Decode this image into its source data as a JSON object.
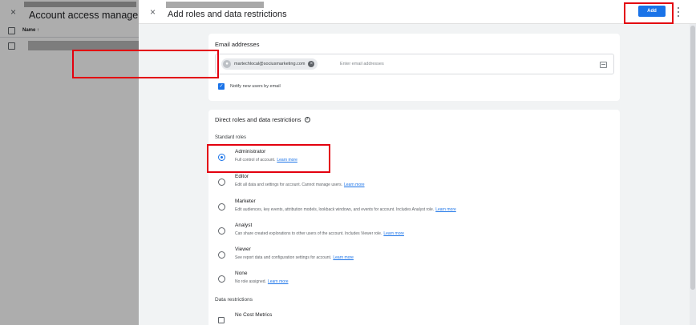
{
  "background_page": {
    "title": "Account access management",
    "close_glyph": "×",
    "column_header": "Name ↑"
  },
  "panel": {
    "title": "Add roles and data restrictions",
    "close_glyph": "×",
    "add_label": "Add"
  },
  "email": {
    "heading": "Email addresses",
    "chip_value": "martechlocal@sociusmarketing.com",
    "placeholder": "Enter email addresses",
    "notify_label": "Notify new users by email",
    "notify_checked": true
  },
  "roles": {
    "heading": "Direct roles and data restrictions",
    "standard_roles_label": "Standard roles",
    "learn_more_label": "Learn more",
    "items": [
      {
        "name": "Administrator",
        "description": "Full control of account.",
        "selected": true
      },
      {
        "name": "Editor",
        "description": "Edit all data and settings for account. Cannot manage users.",
        "selected": false
      },
      {
        "name": "Marketer",
        "description": "Edit audiences, key events, attribution models, lookback windows, and events for account. Includes Analyst role.",
        "selected": false
      },
      {
        "name": "Analyst",
        "description": "Can share created explorations to other users of the account. Includes Viewer role.",
        "selected": false
      },
      {
        "name": "Viewer",
        "description": "See report data and configuration settings for account.",
        "selected": false
      },
      {
        "name": "None",
        "description": "No role assigned.",
        "selected": false
      }
    ],
    "data_restrictions_label": "Data restrictions",
    "no_cost_metrics_label": "No Cost Metrics"
  },
  "colors": {
    "accent": "#1a73e8",
    "highlight": "#e3000f"
  },
  "icons": {
    "close": "close-icon",
    "more": "more-vert-icon",
    "help": "help-icon",
    "remove_chip": "remove-chip-icon",
    "contacts": "contacts-icon"
  }
}
